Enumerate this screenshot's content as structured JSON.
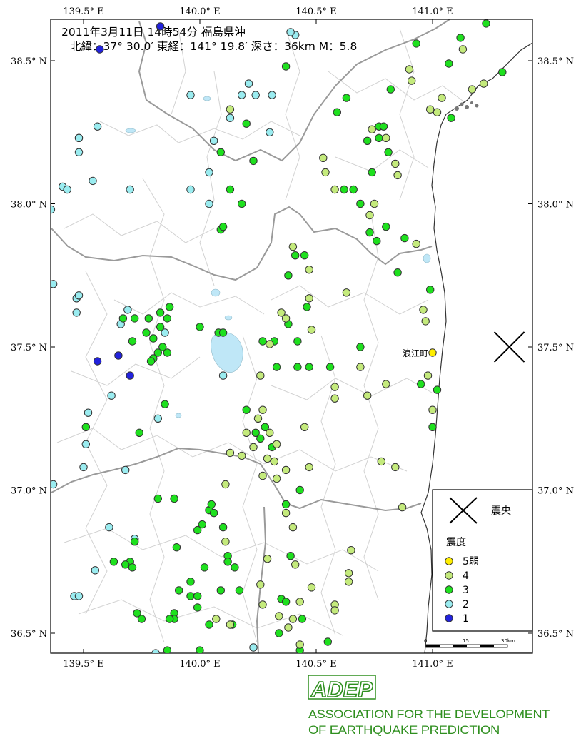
{
  "header": {
    "line1": "2011年3月11日 14時54分  福島県沖",
    "line2": "北緯：37° 30.0′ 東経：141° 19.8′ 深さ：36km  M：5.8"
  },
  "axes": {
    "lon_ticks": [
      {
        "lon": 139.5,
        "label": "139.5° E"
      },
      {
        "lon": 140.0,
        "label": "140.0° E"
      },
      {
        "lon": 140.5,
        "label": "140.5° E"
      },
      {
        "lon": 141.0,
        "label": "141.0° E"
      }
    ],
    "lat_ticks": [
      {
        "lat": 38.5,
        "label": "38.5° N"
      },
      {
        "lat": 38.0,
        "label": "38.0° N"
      },
      {
        "lat": 37.5,
        "label": "37.5° N"
      },
      {
        "lat": 37.0,
        "label": "37.0° N"
      },
      {
        "lat": 36.5,
        "label": "36.5° N"
      }
    ]
  },
  "epicenter": {
    "lon": 141.33,
    "lat": 37.5
  },
  "town_label": {
    "text": "浪江町",
    "lon": 141.0,
    "lat": 37.48
  },
  "legend": {
    "epicenter_label": "震央",
    "intensity_title": "震度",
    "items": [
      {
        "label": "5弱",
        "color": "#ffee00"
      },
      {
        "label": "4",
        "color": "#c4ea7c"
      },
      {
        "label": "3",
        "color": "#1ee01e"
      },
      {
        "label": "2",
        "color": "#9aecf0"
      },
      {
        "label": "1",
        "color": "#2222dd"
      }
    ]
  },
  "scale_bar": {
    "labels": [
      "0",
      "15",
      "30km"
    ]
  },
  "colors": {
    "i5": "#ffee00",
    "i4": "#c4ea7c",
    "i3": "#1ee01e",
    "i2": "#9aecf0",
    "i1": "#2222dd",
    "boundary": "#a0a0a0",
    "muni": "#cfcfcf",
    "coast": "#444444",
    "lake": "#bfe7f7",
    "frame": "#000000"
  },
  "logo": {
    "abbr": "ADEP",
    "line1": "ASSOCIATION  FOR THE DEVELOPMENT",
    "line2": "OF EARTHQUAKE PREDICTION"
  },
  "stations": [
    {
      "lon": 141.0,
      "lat": 37.48,
      "i": 5
    },
    {
      "lon": 140.13,
      "lat": 38.33,
      "i": 4
    },
    {
      "lon": 140.53,
      "lat": 38.16,
      "i": 4
    },
    {
      "lon": 140.54,
      "lat": 38.11,
      "i": 4
    },
    {
      "lon": 140.74,
      "lat": 38.26,
      "i": 4
    },
    {
      "lon": 140.8,
      "lat": 38.23,
      "i": 4
    },
    {
      "lon": 140.84,
      "lat": 38.14,
      "i": 4
    },
    {
      "lon": 140.85,
      "lat": 38.1,
      "i": 4
    },
    {
      "lon": 140.91,
      "lat": 38.43,
      "i": 4
    },
    {
      "lon": 140.9,
      "lat": 38.47,
      "i": 4
    },
    {
      "lon": 140.99,
      "lat": 38.33,
      "i": 4
    },
    {
      "lon": 141.02,
      "lat": 38.32,
      "i": 4
    },
    {
      "lon": 141.04,
      "lat": 38.37,
      "i": 4
    },
    {
      "lon": 141.13,
      "lat": 38.54,
      "i": 4
    },
    {
      "lon": 141.17,
      "lat": 38.4,
      "i": 4
    },
    {
      "lon": 141.22,
      "lat": 38.42,
      "i": 4
    },
    {
      "lon": 140.58,
      "lat": 38.05,
      "i": 4
    },
    {
      "lon": 140.73,
      "lat": 37.96,
      "i": 4
    },
    {
      "lon": 140.75,
      "lat": 38.0,
      "i": 4
    },
    {
      "lon": 140.93,
      "lat": 37.86,
      "i": 4
    },
    {
      "lon": 140.4,
      "lat": 37.85,
      "i": 4
    },
    {
      "lon": 140.47,
      "lat": 37.77,
      "i": 4
    },
    {
      "lon": 140.47,
      "lat": 37.67,
      "i": 4
    },
    {
      "lon": 140.63,
      "lat": 37.69,
      "i": 4
    },
    {
      "lon": 140.37,
      "lat": 37.6,
      "i": 4
    },
    {
      "lon": 140.35,
      "lat": 37.62,
      "i": 4
    },
    {
      "lon": 140.48,
      "lat": 37.56,
      "i": 4
    },
    {
      "lon": 140.3,
      "lat": 37.51,
      "i": 4
    },
    {
      "lon": 140.58,
      "lat": 37.36,
      "i": 4
    },
    {
      "lon": 140.58,
      "lat": 37.32,
      "i": 4
    },
    {
      "lon": 140.69,
      "lat": 37.43,
      "i": 4
    },
    {
      "lon": 140.72,
      "lat": 37.33,
      "i": 4
    },
    {
      "lon": 140.8,
      "lat": 37.37,
      "i": 4
    },
    {
      "lon": 140.98,
      "lat": 37.4,
      "i": 4
    },
    {
      "lon": 141.0,
      "lat": 37.28,
      "i": 4
    },
    {
      "lon": 140.96,
      "lat": 37.63,
      "i": 4
    },
    {
      "lon": 140.97,
      "lat": 37.59,
      "i": 4
    },
    {
      "lon": 140.26,
      "lat": 37.4,
      "i": 4
    },
    {
      "lon": 140.27,
      "lat": 37.28,
      "i": 4
    },
    {
      "lon": 140.25,
      "lat": 37.25,
      "i": 4
    },
    {
      "lon": 140.2,
      "lat": 37.2,
      "i": 4
    },
    {
      "lon": 140.23,
      "lat": 37.15,
      "i": 4
    },
    {
      "lon": 140.13,
      "lat": 37.13,
      "i": 4
    },
    {
      "lon": 140.18,
      "lat": 37.12,
      "i": 4
    },
    {
      "lon": 140.29,
      "lat": 37.11,
      "i": 4
    },
    {
      "lon": 140.27,
      "lat": 37.05,
      "i": 4
    },
    {
      "lon": 140.32,
      "lat": 37.1,
      "i": 4
    },
    {
      "lon": 140.33,
      "lat": 37.04,
      "i": 4
    },
    {
      "lon": 140.33,
      "lat": 37.16,
      "i": 4
    },
    {
      "lon": 140.3,
      "lat": 37.2,
      "i": 4
    },
    {
      "lon": 140.45,
      "lat": 37.22,
      "i": 4
    },
    {
      "lon": 140.47,
      "lat": 37.08,
      "i": 4
    },
    {
      "lon": 140.37,
      "lat": 37.07,
      "i": 4
    },
    {
      "lon": 140.37,
      "lat": 36.92,
      "i": 4
    },
    {
      "lon": 140.4,
      "lat": 36.87,
      "i": 4
    },
    {
      "lon": 140.11,
      "lat": 37.02,
      "i": 4
    },
    {
      "lon": 140.11,
      "lat": 36.82,
      "i": 4
    },
    {
      "lon": 140.29,
      "lat": 36.76,
      "i": 4
    },
    {
      "lon": 140.26,
      "lat": 36.67,
      "i": 4
    },
    {
      "lon": 140.27,
      "lat": 36.6,
      "i": 4
    },
    {
      "lon": 140.34,
      "lat": 36.56,
      "i": 4
    },
    {
      "lon": 140.4,
      "lat": 36.55,
      "i": 4
    },
    {
      "lon": 140.38,
      "lat": 36.52,
      "i": 4
    },
    {
      "lon": 140.43,
      "lat": 36.61,
      "i": 4
    },
    {
      "lon": 140.48,
      "lat": 36.66,
      "i": 4
    },
    {
      "lon": 140.58,
      "lat": 36.6,
      "i": 4
    },
    {
      "lon": 140.58,
      "lat": 36.58,
      "i": 4
    },
    {
      "lon": 140.64,
      "lat": 36.68,
      "i": 4
    },
    {
      "lon": 140.64,
      "lat": 36.71,
      "i": 4
    },
    {
      "lon": 140.65,
      "lat": 36.79,
      "i": 4
    },
    {
      "lon": 140.87,
      "lat": 36.94,
      "i": 4
    },
    {
      "lon": 140.84,
      "lat": 37.08,
      "i": 4
    },
    {
      "lon": 140.78,
      "lat": 37.1,
      "i": 4
    },
    {
      "lon": 140.07,
      "lat": 36.55,
      "i": 4
    },
    {
      "lon": 140.13,
      "lat": 36.53,
      "i": 4
    },
    {
      "lon": 140.41,
      "lat": 36.74,
      "i": 4
    },
    {
      "lon": 140.43,
      "lat": 36.46,
      "i": 4
    },
    {
      "lon": 140.37,
      "lat": 38.48,
      "i": 3
    },
    {
      "lon": 140.2,
      "lat": 38.28,
      "i": 3
    },
    {
      "lon": 140.09,
      "lat": 38.18,
      "i": 3
    },
    {
      "lon": 140.23,
      "lat": 38.15,
      "i": 3
    },
    {
      "lon": 140.13,
      "lat": 38.05,
      "i": 3
    },
    {
      "lon": 140.18,
      "lat": 38.0,
      "i": 3
    },
    {
      "lon": 140.09,
      "lat": 37.91,
      "i": 3
    },
    {
      "lon": 140.1,
      "lat": 37.92,
      "i": 3
    },
    {
      "lon": 140.63,
      "lat": 38.37,
      "i": 3
    },
    {
      "lon": 140.59,
      "lat": 38.32,
      "i": 3
    },
    {
      "lon": 140.74,
      "lat": 38.11,
      "i": 3
    },
    {
      "lon": 140.77,
      "lat": 38.23,
      "i": 3
    },
    {
      "lon": 140.72,
      "lat": 38.22,
      "i": 3
    },
    {
      "lon": 140.81,
      "lat": 38.18,
      "i": 3
    },
    {
      "lon": 140.77,
      "lat": 38.27,
      "i": 3
    },
    {
      "lon": 140.79,
      "lat": 38.27,
      "i": 3
    },
    {
      "lon": 140.82,
      "lat": 38.4,
      "i": 3
    },
    {
      "lon": 140.93,
      "lat": 38.56,
      "i": 3
    },
    {
      "lon": 141.07,
      "lat": 38.49,
      "i": 3
    },
    {
      "lon": 141.08,
      "lat": 38.3,
      "i": 3
    },
    {
      "lon": 141.12,
      "lat": 38.58,
      "i": 3
    },
    {
      "lon": 141.23,
      "lat": 38.63,
      "i": 3
    },
    {
      "lon": 141.3,
      "lat": 38.46,
      "i": 3
    },
    {
      "lon": 140.85,
      "lat": 37.76,
      "i": 3
    },
    {
      "lon": 140.88,
      "lat": 37.88,
      "i": 3
    },
    {
      "lon": 140.8,
      "lat": 37.92,
      "i": 3
    },
    {
      "lon": 140.69,
      "lat": 38.0,
      "i": 3
    },
    {
      "lon": 140.62,
      "lat": 38.05,
      "i": 3
    },
    {
      "lon": 140.66,
      "lat": 38.05,
      "i": 3
    },
    {
      "lon": 140.76,
      "lat": 37.87,
      "i": 3
    },
    {
      "lon": 140.73,
      "lat": 37.9,
      "i": 3
    },
    {
      "lon": 140.41,
      "lat": 37.82,
      "i": 3
    },
    {
      "lon": 140.45,
      "lat": 37.82,
      "i": 3
    },
    {
      "lon": 140.38,
      "lat": 37.75,
      "i": 3
    },
    {
      "lon": 140.42,
      "lat": 37.52,
      "i": 3
    },
    {
      "lon": 140.38,
      "lat": 37.58,
      "i": 3
    },
    {
      "lon": 140.46,
      "lat": 37.64,
      "i": 3
    },
    {
      "lon": 140.27,
      "lat": 37.52,
      "i": 3
    },
    {
      "lon": 140.32,
      "lat": 37.52,
      "i": 3
    },
    {
      "lon": 140.33,
      "lat": 37.43,
      "i": 3
    },
    {
      "lon": 140.42,
      "lat": 37.43,
      "i": 3
    },
    {
      "lon": 140.47,
      "lat": 37.43,
      "i": 3
    },
    {
      "lon": 140.08,
      "lat": 37.55,
      "i": 3
    },
    {
      "lon": 140.1,
      "lat": 37.55,
      "i": 3
    },
    {
      "lon": 140.0,
      "lat": 37.57,
      "i": 3
    },
    {
      "lon": 139.86,
      "lat": 37.6,
      "i": 3
    },
    {
      "lon": 139.87,
      "lat": 37.64,
      "i": 3
    },
    {
      "lon": 139.83,
      "lat": 37.62,
      "i": 3
    },
    {
      "lon": 139.78,
      "lat": 37.6,
      "i": 3
    },
    {
      "lon": 139.83,
      "lat": 37.57,
      "i": 3
    },
    {
      "lon": 139.77,
      "lat": 37.55,
      "i": 3
    },
    {
      "lon": 139.8,
      "lat": 37.53,
      "i": 3
    },
    {
      "lon": 139.84,
      "lat": 37.5,
      "i": 3
    },
    {
      "lon": 139.86,
      "lat": 37.48,
      "i": 3
    },
    {
      "lon": 139.82,
      "lat": 37.48,
      "i": 3
    },
    {
      "lon": 139.8,
      "lat": 37.46,
      "i": 3
    },
    {
      "lon": 139.79,
      "lat": 37.45,
      "i": 3
    },
    {
      "lon": 139.72,
      "lat": 37.6,
      "i": 3
    },
    {
      "lon": 139.71,
      "lat": 37.52,
      "i": 3
    },
    {
      "lon": 139.67,
      "lat": 37.6,
      "i": 3
    },
    {
      "lon": 139.85,
      "lat": 37.3,
      "i": 3
    },
    {
      "lon": 139.74,
      "lat": 37.2,
      "i": 3
    },
    {
      "lon": 139.51,
      "lat": 37.22,
      "i": 3
    },
    {
      "lon": 139.3,
      "lat": 37.35,
      "i": 3
    },
    {
      "lon": 140.2,
      "lat": 37.28,
      "i": 3
    },
    {
      "lon": 140.28,
      "lat": 37.22,
      "i": 3
    },
    {
      "lon": 140.24,
      "lat": 37.2,
      "i": 3
    },
    {
      "lon": 140.26,
      "lat": 37.18,
      "i": 3
    },
    {
      "lon": 140.31,
      "lat": 37.15,
      "i": 3
    },
    {
      "lon": 140.43,
      "lat": 37.0,
      "i": 3
    },
    {
      "lon": 140.37,
      "lat": 36.95,
      "i": 3
    },
    {
      "lon": 140.69,
      "lat": 37.5,
      "i": 3
    },
    {
      "lon": 140.56,
      "lat": 37.43,
      "i": 3
    },
    {
      "lon": 140.95,
      "lat": 37.37,
      "i": 3
    },
    {
      "lon": 141.02,
      "lat": 37.35,
      "i": 3
    },
    {
      "lon": 140.99,
      "lat": 37.7,
      "i": 3
    },
    {
      "lon": 141.0,
      "lat": 37.22,
      "i": 3
    },
    {
      "lon": 139.82,
      "lat": 36.97,
      "i": 3
    },
    {
      "lon": 139.89,
      "lat": 36.97,
      "i": 3
    },
    {
      "lon": 140.04,
      "lat": 36.93,
      "i": 3
    },
    {
      "lon": 140.06,
      "lat": 36.92,
      "i": 3
    },
    {
      "lon": 140.05,
      "lat": 36.95,
      "i": 3
    },
    {
      "lon": 140.01,
      "lat": 36.88,
      "i": 3
    },
    {
      "lon": 140.1,
      "lat": 36.87,
      "i": 3
    },
    {
      "lon": 139.99,
      "lat": 36.86,
      "i": 3
    },
    {
      "lon": 139.72,
      "lat": 36.82,
      "i": 3
    },
    {
      "lon": 139.9,
      "lat": 36.8,
      "i": 3
    },
    {
      "lon": 139.7,
      "lat": 36.75,
      "i": 3
    },
    {
      "lon": 139.71,
      "lat": 36.73,
      "i": 3
    },
    {
      "lon": 139.68,
      "lat": 36.74,
      "i": 3
    },
    {
      "lon": 139.63,
      "lat": 36.75,
      "i": 3
    },
    {
      "lon": 140.12,
      "lat": 36.77,
      "i": 3
    },
    {
      "lon": 140.12,
      "lat": 36.75,
      "i": 3
    },
    {
      "lon": 140.15,
      "lat": 36.73,
      "i": 3
    },
    {
      "lon": 140.02,
      "lat": 36.73,
      "i": 3
    },
    {
      "lon": 139.96,
      "lat": 36.68,
      "i": 3
    },
    {
      "lon": 140.09,
      "lat": 36.65,
      "i": 3
    },
    {
      "lon": 140.17,
      "lat": 36.65,
      "i": 3
    },
    {
      "lon": 139.96,
      "lat": 36.63,
      "i": 3
    },
    {
      "lon": 139.99,
      "lat": 36.63,
      "i": 3
    },
    {
      "lon": 139.73,
      "lat": 36.57,
      "i": 3
    },
    {
      "lon": 139.75,
      "lat": 36.55,
      "i": 3
    },
    {
      "lon": 139.89,
      "lat": 36.57,
      "i": 3
    },
    {
      "lon": 139.89,
      "lat": 36.55,
      "i": 3
    },
    {
      "lon": 139.87,
      "lat": 36.55,
      "i": 3
    },
    {
      "lon": 140.04,
      "lat": 36.53,
      "i": 3
    },
    {
      "lon": 140.14,
      "lat": 36.53,
      "i": 3
    },
    {
      "lon": 140.34,
      "lat": 36.5,
      "i": 3
    },
    {
      "lon": 140.35,
      "lat": 36.62,
      "i": 3
    },
    {
      "lon": 140.37,
      "lat": 36.61,
      "i": 3
    },
    {
      "lon": 140.44,
      "lat": 36.55,
      "i": 3
    },
    {
      "lon": 140.39,
      "lat": 36.77,
      "i": 3
    },
    {
      "lon": 140.55,
      "lat": 36.47,
      "i": 3
    },
    {
      "lon": 140.43,
      "lat": 36.44,
      "i": 3
    },
    {
      "lon": 140.0,
      "lat": 36.44,
      "i": 3
    },
    {
      "lon": 139.86,
      "lat": 36.44,
      "i": 3
    },
    {
      "lon": 139.99,
      "lat": 36.59,
      "i": 3
    },
    {
      "lon": 139.91,
      "lat": 36.65,
      "i": 3
    },
    {
      "lon": 140.41,
      "lat": 38.59,
      "i": 2
    },
    {
      "lon": 140.39,
      "lat": 38.6,
      "i": 2
    },
    {
      "lon": 140.31,
      "lat": 38.38,
      "i": 2
    },
    {
      "lon": 140.21,
      "lat": 38.42,
      "i": 2
    },
    {
      "lon": 140.18,
      "lat": 38.38,
      "i": 2
    },
    {
      "lon": 140.24,
      "lat": 38.38,
      "i": 2
    },
    {
      "lon": 140.13,
      "lat": 38.3,
      "i": 2
    },
    {
      "lon": 140.3,
      "lat": 38.25,
      "i": 2
    },
    {
      "lon": 139.96,
      "lat": 38.38,
      "i": 2
    },
    {
      "lon": 140.06,
      "lat": 38.22,
      "i": 2
    },
    {
      "lon": 140.04,
      "lat": 38.11,
      "i": 2
    },
    {
      "lon": 139.96,
      "lat": 38.05,
      "i": 2
    },
    {
      "lon": 140.04,
      "lat": 38.0,
      "i": 2
    },
    {
      "lon": 139.7,
      "lat": 38.05,
      "i": 2
    },
    {
      "lon": 139.56,
      "lat": 38.27,
      "i": 2
    },
    {
      "lon": 139.48,
      "lat": 38.23,
      "i": 2
    },
    {
      "lon": 139.48,
      "lat": 38.18,
      "i": 2
    },
    {
      "lon": 139.54,
      "lat": 38.08,
      "i": 2
    },
    {
      "lon": 139.41,
      "lat": 38.06,
      "i": 2
    },
    {
      "lon": 139.43,
      "lat": 38.05,
      "i": 2
    },
    {
      "lon": 139.31,
      "lat": 38.02,
      "i": 2
    },
    {
      "lon": 139.36,
      "lat": 37.98,
      "i": 2
    },
    {
      "lon": 139.3,
      "lat": 37.95,
      "i": 2
    },
    {
      "lon": 139.31,
      "lat": 37.92,
      "i": 2
    },
    {
      "lon": 139.37,
      "lat": 37.72,
      "i": 2
    },
    {
      "lon": 139.47,
      "lat": 37.67,
      "i": 2
    },
    {
      "lon": 139.48,
      "lat": 37.68,
      "i": 2
    },
    {
      "lon": 139.47,
      "lat": 37.62,
      "i": 2
    },
    {
      "lon": 139.66,
      "lat": 37.58,
      "i": 2
    },
    {
      "lon": 139.69,
      "lat": 37.63,
      "i": 2
    },
    {
      "lon": 139.85,
      "lat": 37.55,
      "i": 2
    },
    {
      "lon": 139.52,
      "lat": 37.27,
      "i": 2
    },
    {
      "lon": 139.51,
      "lat": 37.16,
      "i": 2
    },
    {
      "lon": 139.82,
      "lat": 37.25,
      "i": 2
    },
    {
      "lon": 139.62,
      "lat": 37.33,
      "i": 2
    },
    {
      "lon": 139.5,
      "lat": 37.08,
      "i": 2
    },
    {
      "lon": 139.68,
      "lat": 37.07,
      "i": 2
    },
    {
      "lon": 139.37,
      "lat": 37.02,
      "i": 2
    },
    {
      "lon": 139.61,
      "lat": 36.87,
      "i": 2
    },
    {
      "lon": 139.72,
      "lat": 36.83,
      "i": 2
    },
    {
      "lon": 139.55,
      "lat": 36.72,
      "i": 2
    },
    {
      "lon": 139.46,
      "lat": 36.63,
      "i": 2
    },
    {
      "lon": 139.48,
      "lat": 36.63,
      "i": 2
    },
    {
      "lon": 139.3,
      "lat": 36.52,
      "i": 2
    },
    {
      "lon": 139.81,
      "lat": 36.43,
      "i": 2
    },
    {
      "lon": 139.86,
      "lat": 36.43,
      "i": 2
    },
    {
      "lon": 140.23,
      "lat": 36.45,
      "i": 2
    },
    {
      "lon": 140.1,
      "lat": 37.4,
      "i": 2
    },
    {
      "lon": 139.7,
      "lat": 37.4,
      "i": 1
    },
    {
      "lon": 139.65,
      "lat": 37.47,
      "i": 1
    },
    {
      "lon": 139.56,
      "lat": 37.45,
      "i": 1
    },
    {
      "lon": 139.48,
      "lat": 38.23,
      "i": 1
    },
    {
      "lon": 139.57,
      "lat": 38.54,
      "i": 1
    },
    {
      "lon": 139.83,
      "lat": 38.62,
      "i": 1
    }
  ]
}
